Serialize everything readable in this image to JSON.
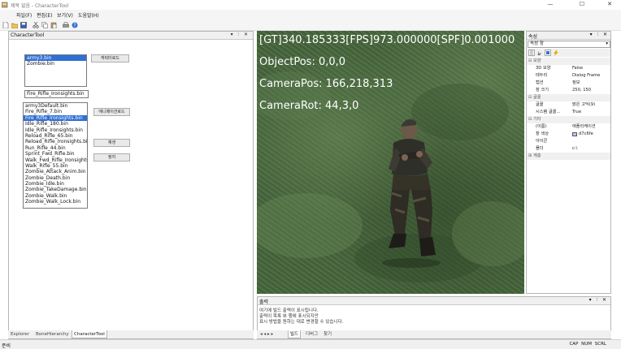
{
  "window": {
    "title": "제목 없음 - CharacterTool",
    "controls": [
      "—",
      "☐",
      "✕"
    ]
  },
  "menu": [
    "파일(F)",
    "편집(E)",
    "보기(V)",
    "도움말(H)"
  ],
  "left_panel": {
    "title": "CharacterTool",
    "header_buttons": "▾ ⫶ ✕",
    "mesh_list": [
      "army3.bin",
      "Zombie.bin"
    ],
    "mesh_selected": 0,
    "btn_cat": "캐릭터로드",
    "anim_textbox": "Fire_Rifle_Ironsights.bin",
    "anim_list": [
      "army3Default.bin",
      "Fire_Rifle_7.bin",
      "Fire_Rifle_Ironsights.bin",
      "Idle_Rifle_180.bin",
      "Idle_Rifle_Ironsights.bin",
      "Reload_Rifle_65.bin",
      "Reload_Rifle_Ironsights.bin",
      "Run_Rifle_44.bin",
      "Sprint_Fwd_Rifle.bin",
      "Walk_Fwd_Rifle_Ironsights",
      "Walk_Rifle_55.bin",
      "Zombie_Attack_Anim.bin",
      "Zombie_Death.bin",
      "Zombie_Idle.bin",
      "Zombie_TakeDamage.bin",
      "Zombie_Walk.bin",
      "Zombie_Walk_Lock.bin"
    ],
    "anim_selected": 2,
    "btn_anim": "애니메이션로드",
    "btn_play": "재생",
    "btn_stop": "정지",
    "tabs": [
      "Explorer",
      "BoneHierarchy",
      "CharacterTool"
    ],
    "active_tab": 2
  },
  "viewport": {
    "hud_lines": [
      "[GT]340.185333[FPS]973.000000[SPF]0.001000",
      "ObjectPos: 0,0,0",
      "CameraPos: 166,218,313",
      "CameraRot: 44,3,0"
    ]
  },
  "properties": {
    "title": "속성",
    "header_buttons": "▾ ⫶ ✕",
    "combo": "속성 창",
    "categories": [
      {
        "name": "모양",
        "rows": [
          [
            "3D 모양",
            "False"
          ],
          [
            "테두리",
            "Dialog Frame"
          ],
          [
            "캡션",
            "정보"
          ],
          [
            "창 크기",
            "250, 150"
          ]
        ]
      },
      {
        "name": "글꼴",
        "rows": [
          [
            "글꼴",
            "맑은 고딕(9)"
          ],
          [
            "시스템 글꼴...",
            "True"
          ]
        ]
      },
      {
        "name": "기타",
        "rows": [
          [
            "(이름)",
            "애플리케이션"
          ],
          [
            "창 색상",
            "d7c6fe"
          ],
          [
            "아이콘",
            ""
          ],
          [
            "폴더",
            "c:\\"
          ]
        ]
      },
      {
        "name": "계층",
        "rows": []
      }
    ],
    "swatch_color": "#c7c2f6"
  },
  "output": {
    "title": "출력",
    "header_buttons": "▾ ⫶ ✕",
    "lines": [
      "여기에 빌드 출력이 표시됩니다.",
      "출력이 목록 뷰 행에 표시되지만",
      "표시 방법을 원하는 대로 변경할 수 있습니다."
    ],
    "tabs": [
      "빌드",
      "디버그",
      "찾기"
    ],
    "nav": "◂ ◂ ▸ ▸"
  },
  "status": {
    "left": "준비",
    "right": "CAP  NUM  SCRL"
  },
  "colors": {
    "selection": "#2f6fd6",
    "hud_text": "#ffffff",
    "terrain": "#4a6840"
  }
}
